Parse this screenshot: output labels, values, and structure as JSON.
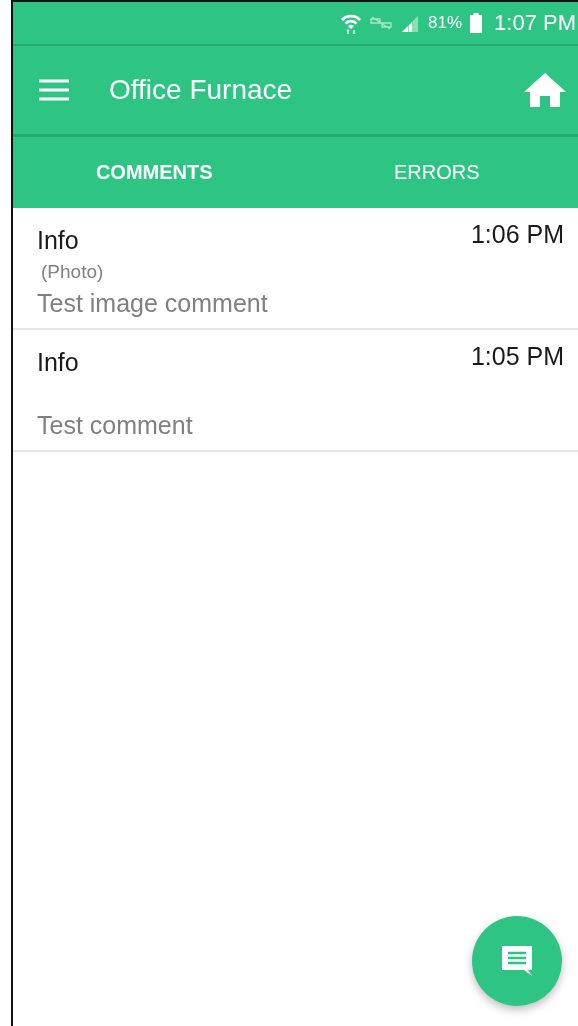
{
  "status_bar": {
    "battery_text": "81%",
    "time": "1:07 PM"
  },
  "app_bar": {
    "title": "Office Furnace"
  },
  "tabs": [
    {
      "label": "COMMENTS",
      "selected": true
    },
    {
      "label": "ERRORS",
      "selected": false
    }
  ],
  "comments": [
    {
      "type": "Info",
      "time": "1:06 PM",
      "attachment": "(Photo)",
      "text": "Test image comment"
    },
    {
      "type": "Info",
      "time": "1:05 PM",
      "text": "Test comment"
    }
  ]
}
